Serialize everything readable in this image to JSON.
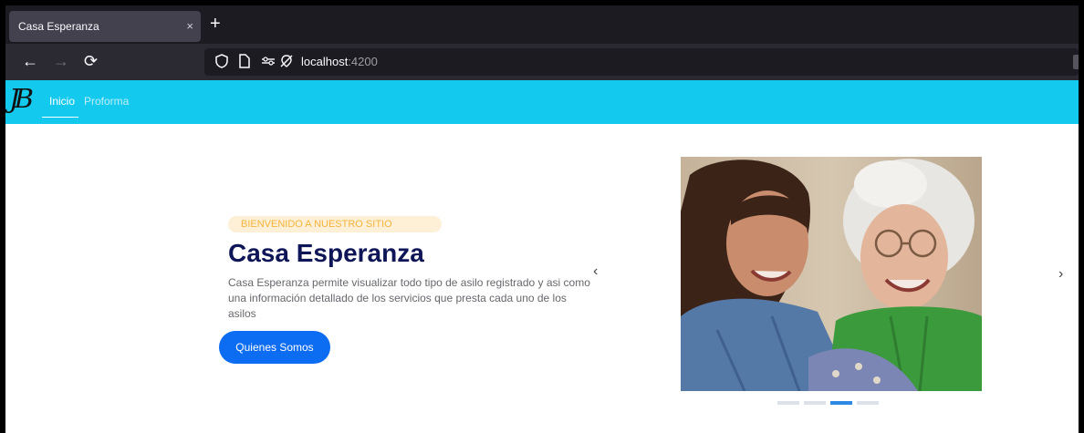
{
  "browser": {
    "tab_title": "Casa Esperanza",
    "tab_close": "×",
    "new_tab": "+",
    "url_host": "localhost",
    "url_port": ":4200"
  },
  "site": {
    "logo_text": "JB",
    "menu": [
      {
        "label": "Inicio",
        "active": true
      },
      {
        "label": "Proforma",
        "active": false
      }
    ]
  },
  "hero": {
    "tagline": "BIENVENIDO A NUESTRO SITIO",
    "title": "Casa Esperanza",
    "description": "Casa Esperanza permite visualizar todo tipo de asilo registrado y asi como una información detallado de los servicios que presta cada uno de los asilos",
    "cta_label": "Quienes Somos"
  },
  "carousel": {
    "prev_icon": "‹",
    "next_icon": "›",
    "slide_count": 4,
    "active_index": 2
  },
  "colors": {
    "header": "#13c9ee",
    "accent": "#0c6cf2",
    "title": "#0f1658",
    "tagline": "#f4b43c"
  }
}
